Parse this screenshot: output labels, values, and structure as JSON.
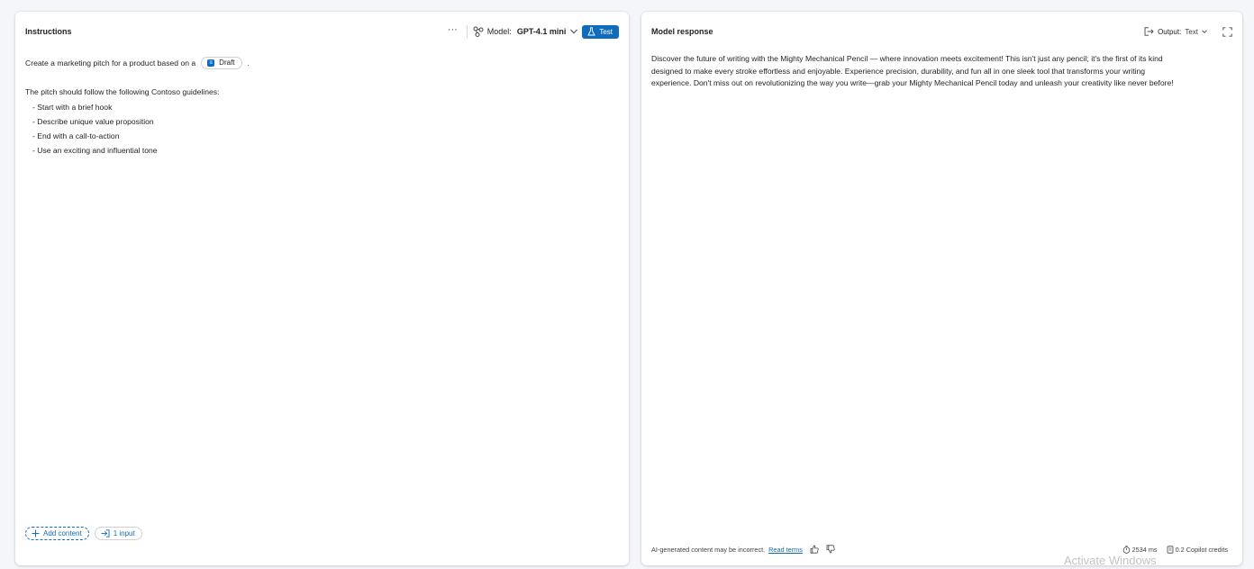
{
  "instructions_panel": {
    "title": "Instructions",
    "more_label": "···",
    "model_label": "Model:",
    "model_value": "GPT-4.1 mini",
    "test_label": "Test",
    "prompt_prefix": "Create a marketing pitch for a product based on a",
    "draft_chip_label": "Draft",
    "prompt_suffix": ".",
    "guidelines_intro": "The pitch should follow the following Contoso guidelines:",
    "guidelines": [
      "- Start with a brief hook",
      "- Describe unique value proposition",
      "- End with a call-to-action",
      "- Use an exciting and influential tone"
    ],
    "add_content_label": "Add content",
    "input_count_label": "1 input"
  },
  "response_panel": {
    "title": "Model response",
    "output_label": "Output:",
    "output_value": "Text",
    "response_lines": [
      "Discover the future of writing with the Mighty Mechanical Pencil — where innovation meets excitement! This isn't just any pencil; it's the first of its kind",
      "designed to make every stroke effortless and enjoyable. Experience precision, durability, and fun all in one sleek tool that transforms your writing",
      "experience. Don't miss out on revolutionizing the way you write—grab your Mighty Mechanical Pencil today and unleash your creativity like never before!"
    ],
    "disclaimer": "AI-generated content may be incorrect.",
    "read_terms_label": "Read terms",
    "latency": "2534 ms",
    "credits": "0.2 Copilot credits"
  },
  "watermark": "Activate Windows",
  "colors": {
    "accent": "#0f6cbd",
    "background": "#f5f6fa",
    "panel": "#ffffff"
  },
  "icons": [
    "more-icon",
    "model-icon",
    "chevron-down-icon",
    "flask-icon",
    "draft-file-icon",
    "add-icon",
    "input-icon",
    "output-icon",
    "expand-icon",
    "thumbs-up-icon",
    "thumbs-down-icon",
    "timer-icon",
    "credits-icon"
  ]
}
